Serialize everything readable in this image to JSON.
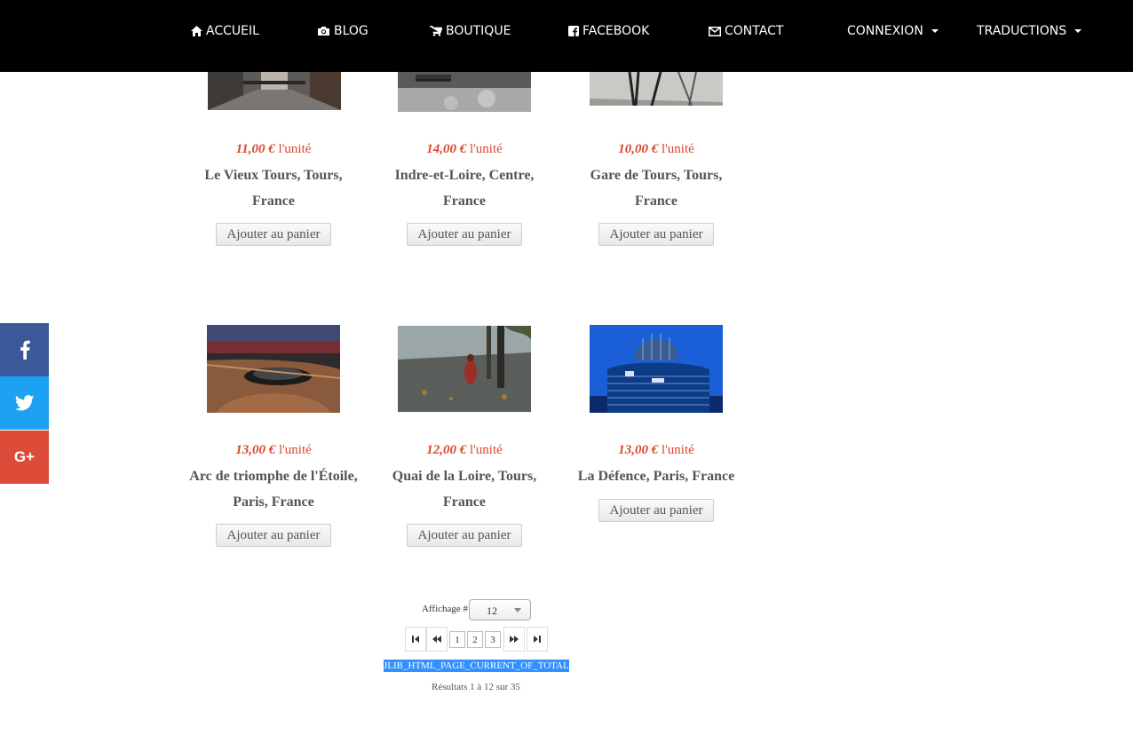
{
  "nav": {
    "home": "ACCUEIL",
    "blog": "BLOG",
    "shop": "BOUTIQUE",
    "facebook": "FACEBOOK",
    "contact": "CONTACT",
    "login": "CONNEXION",
    "translations": "TRADUCTIONS"
  },
  "social": {
    "facebook_icon": "facebook-icon",
    "twitter_icon": "twitter-icon",
    "googleplus_label": "G+"
  },
  "price_suffix": "l'unité",
  "cart_label": "Ajouter au panier",
  "products": [
    {
      "price": "11,00 €",
      "title": "Le Vieux Tours, Tours, France"
    },
    {
      "price": "14,00 €",
      "title": "Indre-et-Loire, Centre, France"
    },
    {
      "price": "10,00 €",
      "title": "Gare de Tours, Tours, France"
    },
    {
      "price": "13,00 €",
      "title": "Arc de triomphe de l'Étoile, Paris, France"
    },
    {
      "price": "12,00 €",
      "title": "Quai de la Loire, Tours, France"
    },
    {
      "price": "13,00 €",
      "title": "La Défence, Paris, France"
    }
  ],
  "pagination": {
    "limit_label": "Affichage #",
    "limit_value": "12",
    "pages": [
      "1",
      "2",
      "3"
    ],
    "current_of_total": "JLIB_HTML_PAGE_CURRENT_OF_TOTAL",
    "results": "Résultats 1 à 12 sur 35"
  },
  "colors": {
    "price": "#d9462b",
    "nav_bg": "#000000",
    "facebook": "#3b5998",
    "twitter": "#1da1f2",
    "googleplus": "#dd4b39",
    "selection": "#3390ff"
  }
}
